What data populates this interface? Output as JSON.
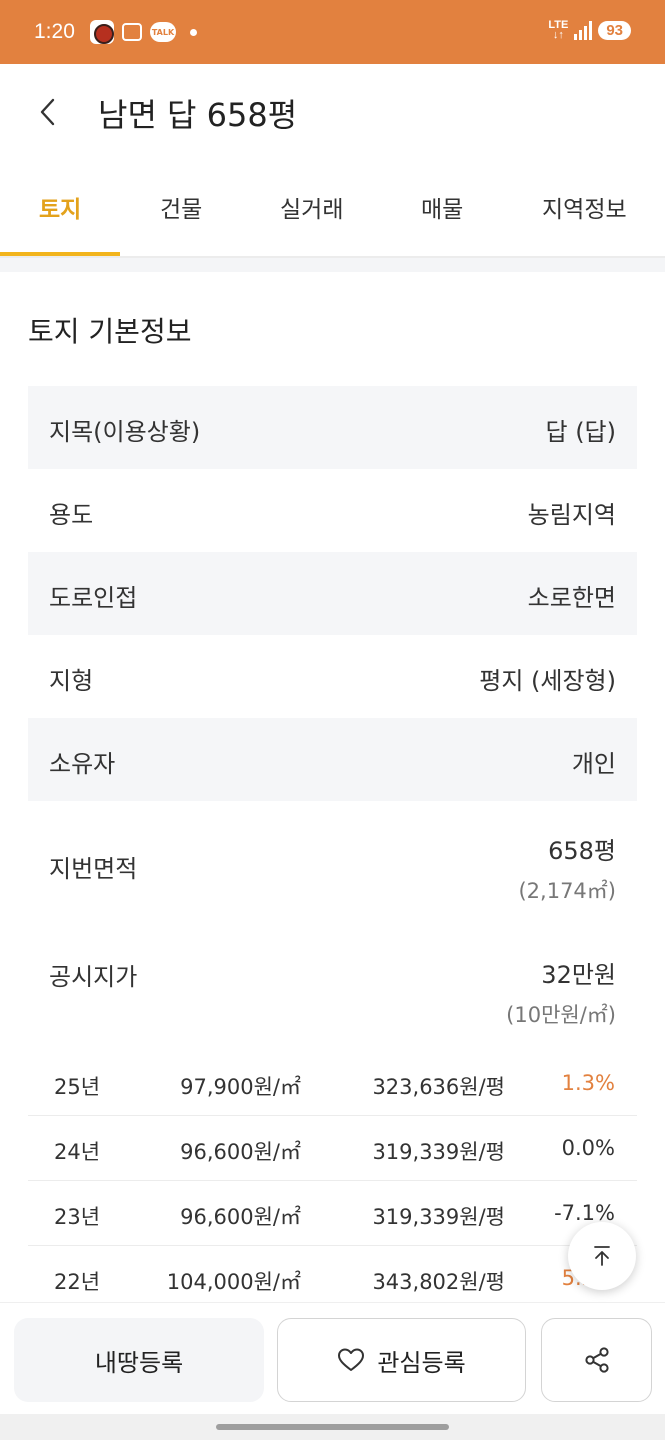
{
  "status_bar": {
    "time": "1:20",
    "talk_label": "TALK",
    "network_top": "LTE",
    "network_bottom": "↓↑",
    "battery": "93",
    "color": "#e2813f"
  },
  "header": {
    "title": "남면 답 658평",
    "back_icon": "chevron-left-icon"
  },
  "tabs": [
    {
      "label": "토지",
      "active": true
    },
    {
      "label": "건물",
      "active": false
    },
    {
      "label": "실거래",
      "active": false
    },
    {
      "label": "매물",
      "active": false
    },
    {
      "label": "지역정보",
      "active": false
    }
  ],
  "section": {
    "title": "토지 기본정보"
  },
  "info_rows": [
    {
      "label": "지목(이용상황)",
      "value": "답 (답)"
    },
    {
      "label": "용도",
      "value": "농림지역"
    },
    {
      "label": "도로인접",
      "value": "소로한면"
    },
    {
      "label": "지형",
      "value": "평지 (세장형)"
    },
    {
      "label": "소유자",
      "value": "개인"
    },
    {
      "label": "지번면적",
      "value": "658평",
      "sub": "(2,174㎡)"
    },
    {
      "label": "공시지가",
      "value": "32만원",
      "sub": "(10만원/㎡)"
    }
  ],
  "price_history": [
    {
      "year": "25년",
      "per_sqm": "97,900원/㎡",
      "per_pyeong": "323,636원/평",
      "rate": "1.3%",
      "up": true
    },
    {
      "year": "24년",
      "per_sqm": "96,600원/㎡",
      "per_pyeong": "319,339원/평",
      "rate": "0.0%",
      "up": false
    },
    {
      "year": "23년",
      "per_sqm": "96,600원/㎡",
      "per_pyeong": "319,339원/평",
      "rate": "-7.1%",
      "up": false
    },
    {
      "year": "22년",
      "per_sqm": "104,000원/㎡",
      "per_pyeong": "343,802원/평",
      "rate": "5.2%",
      "up": true
    }
  ],
  "bottom_actions": {
    "register_label": "내땅등록",
    "favorite_label": "관심등록",
    "favorite_icon": "heart-icon",
    "share_icon": "share-icon"
  },
  "colors": {
    "accent": "#f2b41c",
    "active_tab_text": "#e3a21c",
    "rate_up": "#e2813f"
  }
}
